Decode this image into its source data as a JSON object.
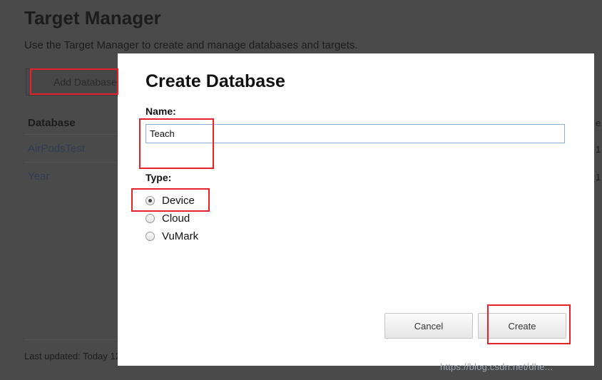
{
  "background": {
    "title": "Target Manager",
    "subtitle": "Use the Target Manager to create and manage databases and targets.",
    "add_database_label": "Add Database",
    "column_header": "Database",
    "rows": [
      "AirPodsTest",
      "Year"
    ],
    "footer": "Last updated: Today 12",
    "right_header_fragment": "e",
    "right_row_fragments": [
      "1",
      "1"
    ]
  },
  "modal": {
    "title": "Create Database",
    "name_label": "Name:",
    "name_value": "Teach",
    "type_label": "Type:",
    "type_options": [
      {
        "label": "Device",
        "selected": true
      },
      {
        "label": "Cloud",
        "selected": false
      },
      {
        "label": "VuMark",
        "selected": false
      }
    ],
    "cancel_label": "Cancel",
    "create_label": "Create"
  },
  "watermark": "https://blog.csdn.net/dhe...",
  "colors": {
    "highlight": "#e8202a",
    "overlay": "#4a4a4a",
    "input_border": "#8aaed6",
    "link": "#2c3e55"
  }
}
